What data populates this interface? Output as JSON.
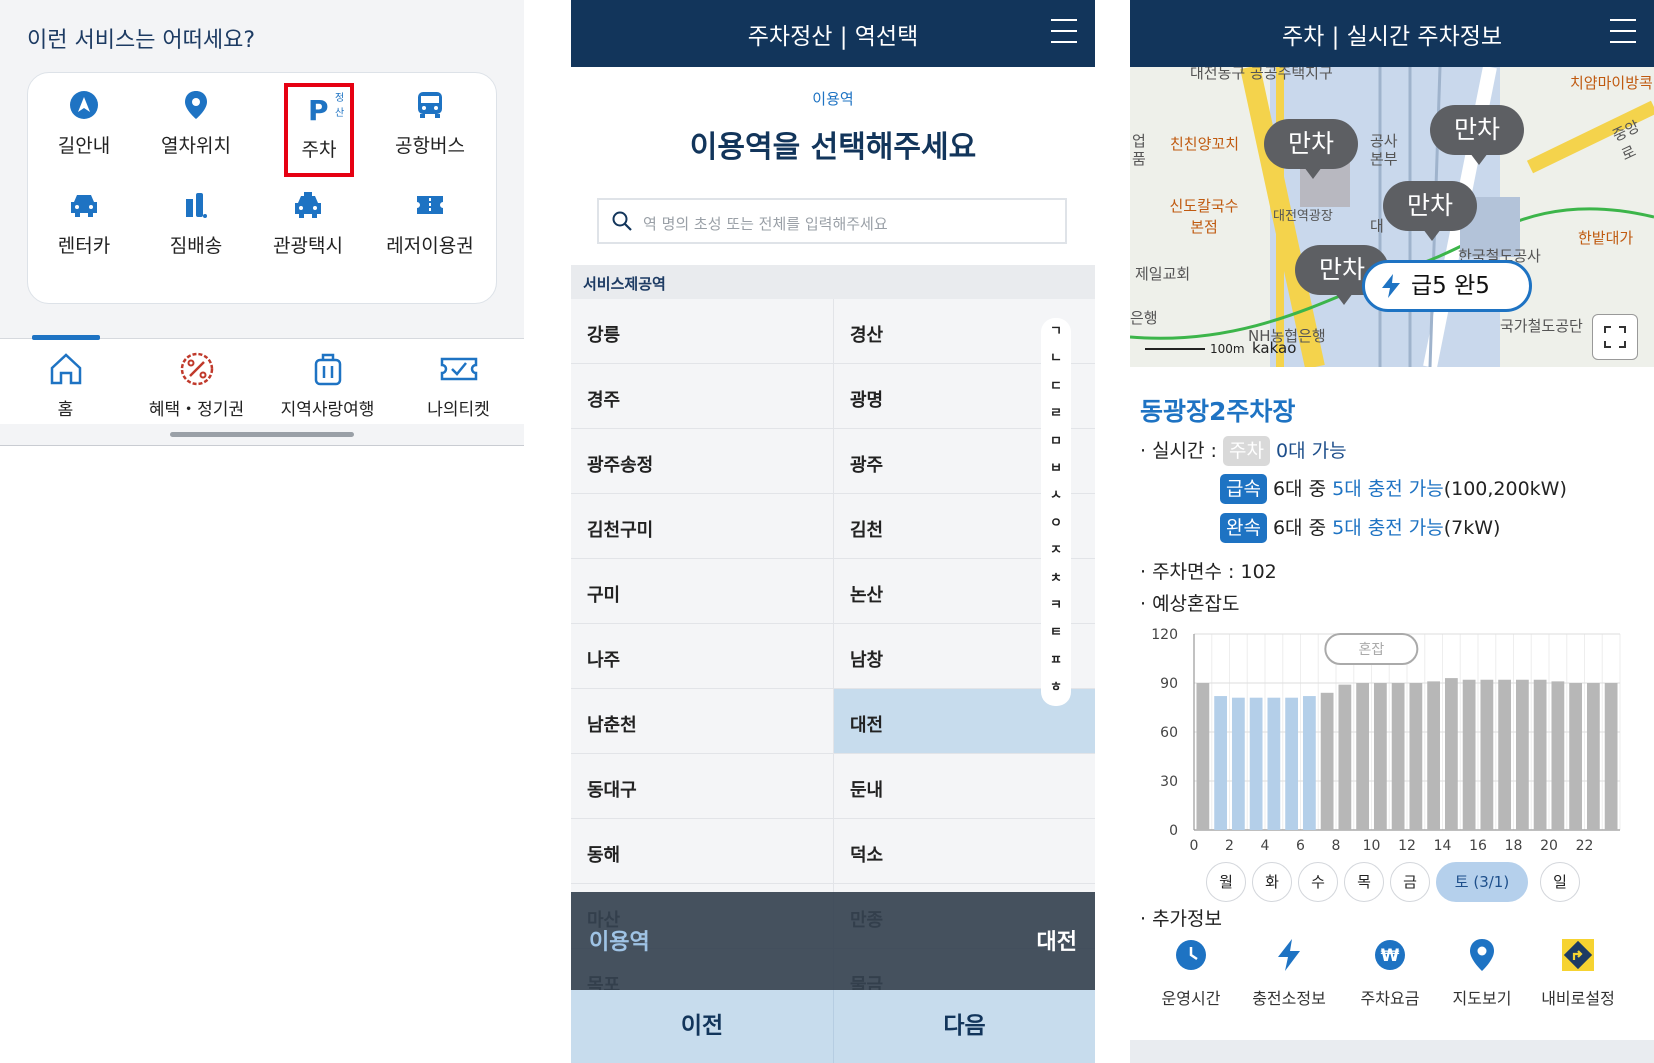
{
  "panel1": {
    "question": "이런 서비스는 어떠세요?",
    "services": [
      {
        "label": "길안내",
        "icon": "navigation-arrow-icon"
      },
      {
        "label": "열차위치",
        "icon": "location-pin-icon"
      },
      {
        "label": "주차",
        "icon": "parking-icon",
        "badge": "정산",
        "highlighted": true
      },
      {
        "label": "공항버스",
        "icon": "bus-icon"
      },
      {
        "label": "렌터카",
        "icon": "car-icon"
      },
      {
        "label": "짐배송",
        "icon": "luggage-icon"
      },
      {
        "label": "관광택시",
        "icon": "taxi-icon"
      },
      {
        "label": "레저이용권",
        "icon": "ticket-icon"
      }
    ],
    "nav": [
      {
        "label": "홈",
        "icon": "home-icon",
        "active": true
      },
      {
        "label": "혜택・정기권",
        "icon": "discount-badge-icon"
      },
      {
        "label": "지역사랑여행",
        "icon": "suitcase-icon"
      },
      {
        "label": "나의티켓",
        "icon": "ticket-check-icon"
      }
    ]
  },
  "panel2": {
    "header_title": "주차정산 | 역선택",
    "small_label": "이용역",
    "title": "이용역을 선택해주세요",
    "search_placeholder": "역 명의 초성 또는 전체를 입력해주세요",
    "list_header": "서비스제공역",
    "stations_left": [
      "강릉",
      "경주",
      "광주송정",
      "김천구미",
      "구미",
      "나주",
      "남춘천",
      "동대구",
      "동해",
      "마산",
      "목포"
    ],
    "stations_right": [
      "경산",
      "광명",
      "광주",
      "김천",
      "논산",
      "남창",
      "대전",
      "둔내",
      "덕소",
      "만종",
      "물금"
    ],
    "selected_station": "대전",
    "index": [
      "ㄱ",
      "ㄴ",
      "ㄷ",
      "ㄹ",
      "ㅁ",
      "ㅂ",
      "ㅅ",
      "ㅇ",
      "ㅈ",
      "ㅊ",
      "ㅋ",
      "ㅌ",
      "ㅍ",
      "ㅎ"
    ],
    "bottom_label": "이용역",
    "bottom_value": "대전",
    "prev": "이전",
    "next": "다음"
  },
  "panel3": {
    "header_title": "주차 | 실시간 주차정보",
    "map": {
      "bubbles": [
        "만차",
        "만차",
        "만차",
        "만차"
      ],
      "ev_label": "급5 완5",
      "labels": [
        "대전동구 공공주택지구",
        "치얌마이방콕",
        "친친양꼬치",
        "신도칼국수 본점",
        "대전역광장",
        "한밭대가",
        "한국철도공사",
        "중앙로",
        "제일교회",
        "NH농협은행",
        "국가철도공단",
        "100m",
        "kakao",
        "공사",
        "본부",
        "은행",
        "업",
        "품",
        "대"
      ]
    },
    "lot_name": "동광장2주차장",
    "realtime_label": "· 실시간 :",
    "parking_tag": "주차",
    "parking_avail": "0대 가능",
    "fast_tag": "급속",
    "fast_total": "6대 중",
    "fast_avail": "5대 충전 가능",
    "fast_power": "(100,200kW)",
    "slow_tag": "완속",
    "slow_total": "6대 중",
    "slow_avail": "5대 충전 가능",
    "slow_power": "(7kW)",
    "spaces": "· 주차면수 : 102",
    "congestion": "· 예상혼잡도",
    "congest_badge": "혼잡",
    "days": [
      "월",
      "화",
      "수",
      "목",
      "금",
      "토 (3/1)",
      "일"
    ],
    "selected_day": "토 (3/1)",
    "extra_title": "· 추가정보",
    "extras": [
      {
        "label": "운영시간",
        "icon": "clock-icon"
      },
      {
        "label": "충전소정보",
        "icon": "lightning-icon"
      },
      {
        "label": "주차요금",
        "icon": "won-coin-icon"
      },
      {
        "label": "지도보기",
        "icon": "map-pin-icon"
      },
      {
        "label": "내비로설정",
        "icon": "navigation-turn-icon"
      }
    ]
  },
  "chart_data": {
    "type": "bar",
    "title": "",
    "xlabel": "",
    "ylabel": "",
    "ylim": [
      0,
      120
    ],
    "yticks": [
      0,
      30,
      60,
      90,
      120
    ],
    "xticks": [
      0,
      2,
      4,
      6,
      8,
      10,
      12,
      14,
      16,
      18,
      20,
      22
    ],
    "categories": [
      0,
      1,
      2,
      3,
      4,
      5,
      6,
      7,
      8,
      9,
      10,
      11,
      12,
      13,
      14,
      15,
      16,
      17,
      18,
      19,
      20,
      21,
      22,
      23
    ],
    "values": [
      90,
      82,
      81,
      81,
      81,
      81,
      82,
      84,
      89,
      90,
      90,
      90,
      90,
      91,
      93,
      92,
      92,
      92,
      92,
      92,
      91,
      90,
      90,
      90
    ],
    "highlighted_range": [
      1,
      6
    ],
    "colors": {
      "normal": "#b7b7b7",
      "highlight": "#b4cfe9"
    },
    "grid": true
  }
}
